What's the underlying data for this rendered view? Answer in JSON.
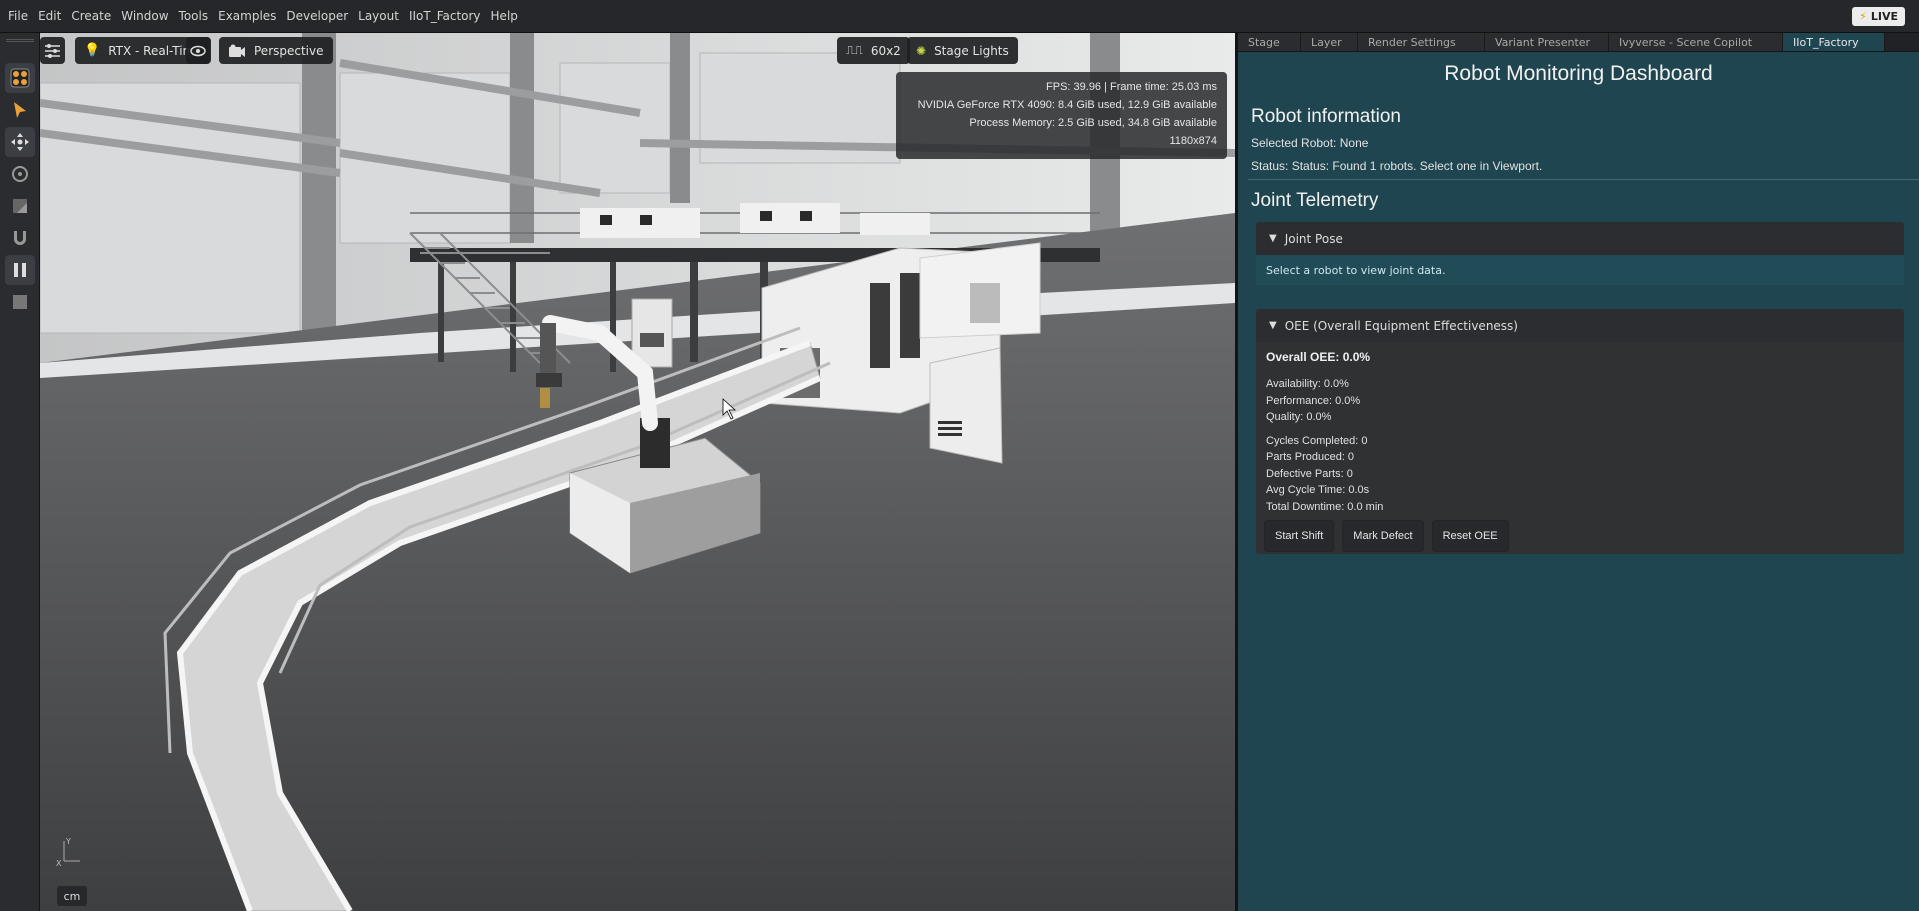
{
  "menu": [
    "File",
    "Edit",
    "Create",
    "Window",
    "Tools",
    "Examples",
    "Developer",
    "Layout",
    "IIoT_Factory",
    "Help"
  ],
  "live_badge": "LIVE",
  "viewport": {
    "render_mode": "RTX - Real-Time",
    "camera": "Perspective",
    "resolution_chip": "60x2",
    "lights": "Stage Lights",
    "stats": {
      "fps": "FPS: 39.96 | Frame time: 25.03 ms",
      "gpu": "NVIDIA GeForce RTX 4090: 8.4 GiB used, 12.9 GiB available",
      "memory": "Process Memory: 2.5 GiB used, 34.8 GiB available",
      "resolution": "1180x874"
    },
    "unit": "cm",
    "axis_x": "X",
    "axis_y": "Y"
  },
  "tabs": [
    {
      "label": "Stage",
      "active": false
    },
    {
      "label": "Layer",
      "active": false
    },
    {
      "label": "Render Settings",
      "active": false
    },
    {
      "label": "Variant Presenter",
      "active": false
    },
    {
      "label": "Ivyverse - Scene Copilot",
      "active": false
    },
    {
      "label": "IIoT_Factory",
      "active": true
    }
  ],
  "dashboard": {
    "title": "Robot Monitoring Dashboard",
    "robot_info": {
      "heading": "Robot information",
      "selected": "Selected Robot: None",
      "status": "Status: Status: Found 1 robots. Select one in Viewport."
    },
    "telemetry": {
      "heading": "Joint Telemetry",
      "joint_pose_title": "Joint Pose",
      "joint_pose_hint": "Select a robot to view joint data."
    },
    "oee": {
      "title": "OEE (Overall Equipment Effectiveness)",
      "overall": "Overall OEE: 0.0%",
      "availability": "Availability: 0.0%",
      "performance": "Performance: 0.0%",
      "quality": "Quality: 0.0%",
      "cycles": "Cycles Completed: 0",
      "parts": "Parts Produced: 0",
      "defective": "Defective Parts: 0",
      "avg_cycle": "Avg Cycle Time: 0.0s",
      "downtime": "Total Downtime: 0.0 min",
      "buttons": {
        "start": "Start Shift",
        "defect": "Mark Defect",
        "reset": "Reset OEE"
      }
    }
  },
  "colors": {
    "panel_bg": "#1f4550",
    "accent": "#e8a13a",
    "hint_bar": "#224b58"
  }
}
